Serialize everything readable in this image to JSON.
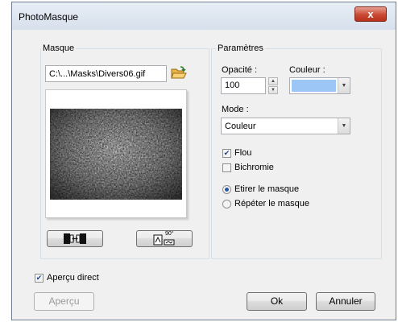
{
  "window": {
    "title": "PhotoMasque",
    "close_glyph": "x"
  },
  "masque": {
    "group_label": "Masque",
    "file_path": "C:\\...\\Masks\\Divers06.gif",
    "browse_icon": "folder-open-icon",
    "tool_buttons": [
      {
        "name": "invert-mask-icon"
      },
      {
        "name": "rotate-mask-icon",
        "text": "90°"
      }
    ]
  },
  "params": {
    "group_label": "Paramètres",
    "opacity_label": "Opacité :",
    "opacity_value": "100",
    "color_label": "Couleur :",
    "color_value": "#9cc6f5",
    "mode_label": "Mode :",
    "mode_value": "Couleur",
    "flou_label": "Flou",
    "flou_checked": true,
    "bichromie_label": "Bichromie",
    "bichromie_checked": false,
    "etirer_label": "Etirer le masque",
    "repeter_label": "Répéter le masque",
    "selected_radio": "etirer"
  },
  "footer": {
    "apercu_direct_label": "Aperçu direct",
    "apercu_direct_checked": true,
    "apercu_button": "Aperçu",
    "ok_button": "Ok",
    "cancel_button": "Annuler"
  }
}
